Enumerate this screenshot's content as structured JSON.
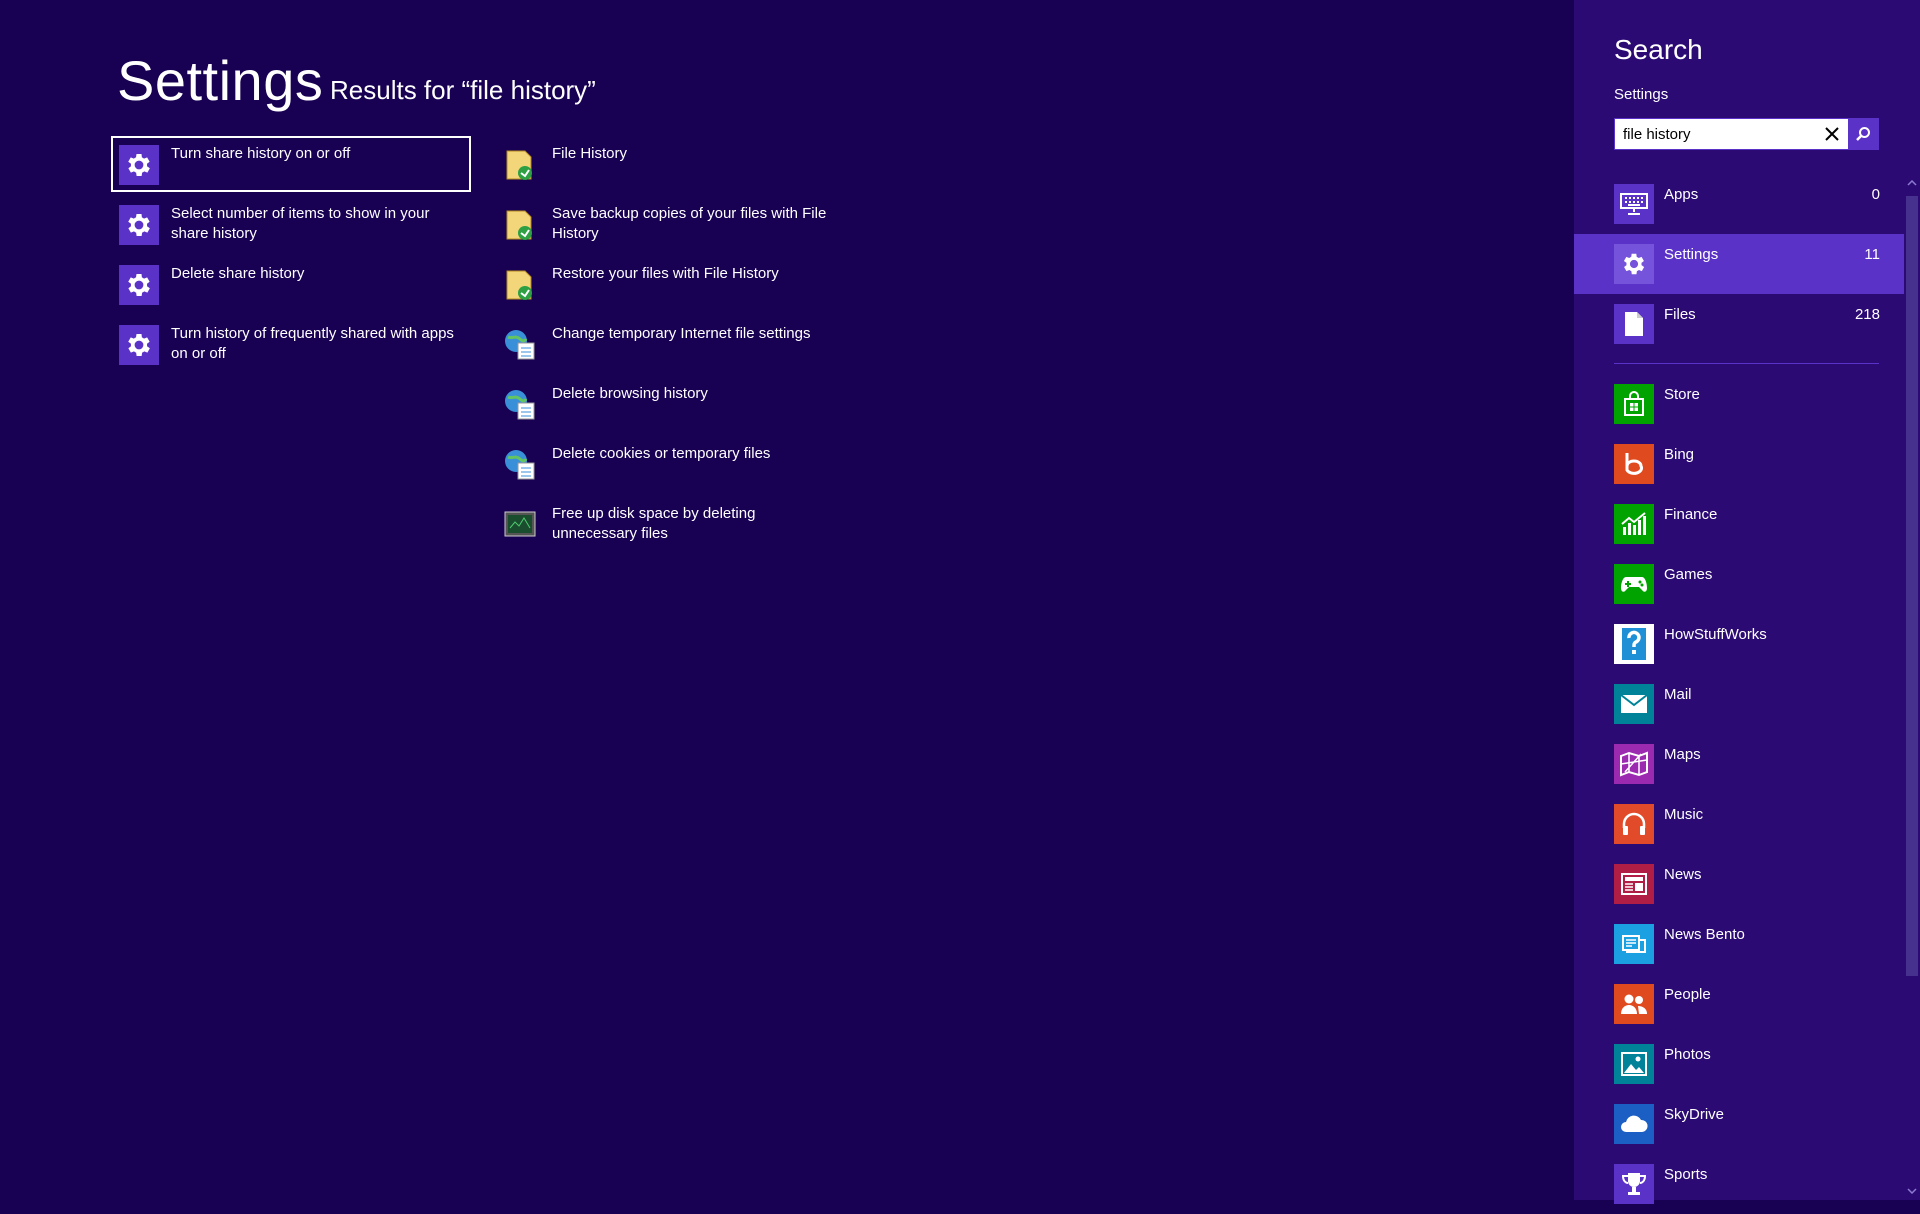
{
  "main": {
    "title": "Settings",
    "subtitle": "Results for “file history”",
    "column1": [
      {
        "label": "Turn share history on or off",
        "icon": "gear-icon"
      },
      {
        "label": "Select number of items to show in your share history",
        "icon": "gear-icon"
      },
      {
        "label": "Delete share history",
        "icon": "gear-icon"
      },
      {
        "label": "Turn history of frequently shared with apps on or off",
        "icon": "gear-icon"
      }
    ],
    "column2": [
      {
        "label": "File History",
        "icon": "file-history-icon"
      },
      {
        "label": "Save backup copies of your files with File History",
        "icon": "file-history-icon"
      },
      {
        "label": "Restore your files with File History",
        "icon": "file-history-icon"
      },
      {
        "label": "Change temporary Internet file settings",
        "icon": "internet-options-icon"
      },
      {
        "label": "Delete browsing history",
        "icon": "internet-options-icon"
      },
      {
        "label": "Delete cookies or temporary files",
        "icon": "internet-options-icon"
      },
      {
        "label": "Free up disk space by deleting unnecessary files",
        "icon": "disk-cleanup-icon"
      }
    ]
  },
  "pane": {
    "title": "Search",
    "scope": "Settings",
    "search_value": "file history",
    "scopes": [
      {
        "label": "Apps",
        "count": "0",
        "icon": "keyboard-icon"
      },
      {
        "label": "Settings",
        "count": "11",
        "icon": "gear-icon"
      },
      {
        "label": "Files",
        "count": "218",
        "icon": "document-icon"
      }
    ],
    "apps": [
      {
        "label": "Store",
        "color": "#00a300",
        "icon": "store-icon"
      },
      {
        "label": "Bing",
        "color": "#e04a1f",
        "icon": "bing-icon"
      },
      {
        "label": "Finance",
        "color": "#00a300",
        "icon": "finance-icon"
      },
      {
        "label": "Games",
        "color": "#00a300",
        "icon": "games-icon"
      },
      {
        "label": "HowStuffWorks",
        "color": "#1f8fd6",
        "icon": "question-icon"
      },
      {
        "label": "Mail",
        "color": "#008299",
        "icon": "mail-icon"
      },
      {
        "label": "Maps",
        "color": "#9b2ab0",
        "icon": "maps-icon"
      },
      {
        "label": "Music",
        "color": "#e24b2a",
        "icon": "headphones-icon"
      },
      {
        "label": "News",
        "color": "#b01e46",
        "icon": "news-icon"
      },
      {
        "label": "News Bento",
        "color": "#1ba1e2",
        "icon": "news-bento-icon"
      },
      {
        "label": "People",
        "color": "#e04a1f",
        "icon": "people-icon"
      },
      {
        "label": "Photos",
        "color": "#008299",
        "icon": "photos-icon"
      },
      {
        "label": "SkyDrive",
        "color": "#1c5fc4",
        "icon": "cloud-icon"
      },
      {
        "label": "Sports",
        "color": "#5a32c7",
        "icon": "trophy-icon"
      }
    ]
  }
}
